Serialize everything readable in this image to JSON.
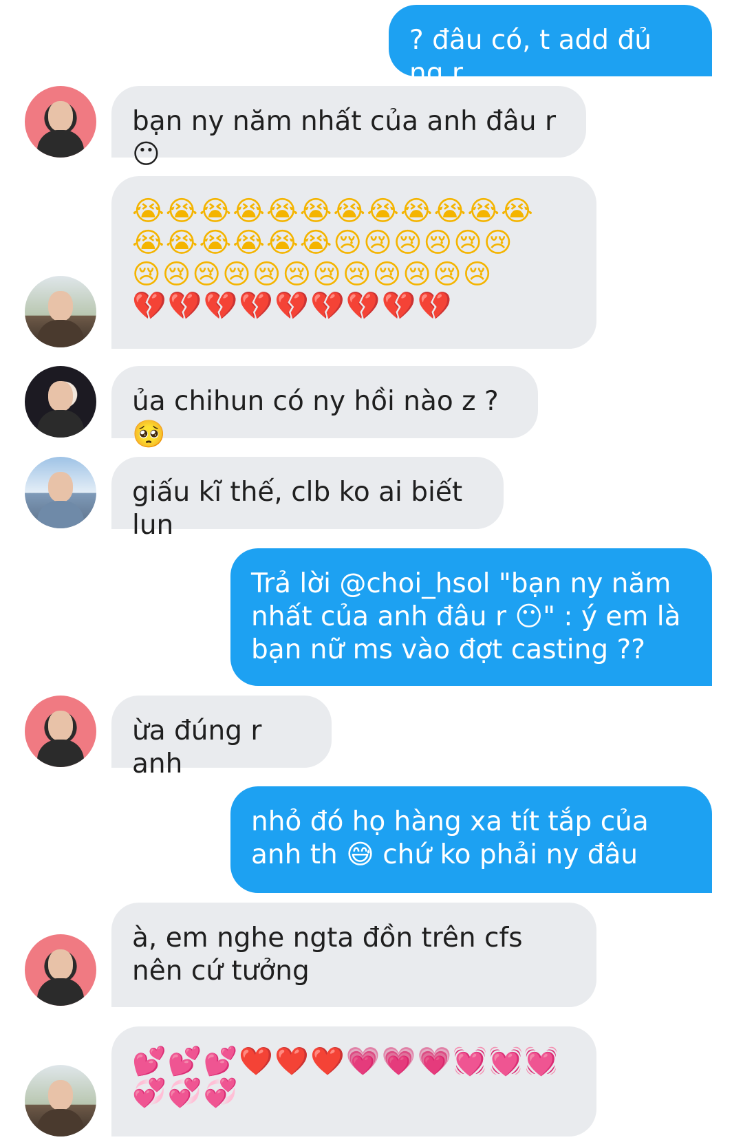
{
  "messages": [
    {
      "side": "out",
      "text": "? đâu có, t add đủ ng r"
    },
    {
      "side": "in",
      "avatar": "avatar-a",
      "text": "bạn ny năm nhất của anh đâu r 😶"
    },
    {
      "side": "in",
      "avatar": "avatar-b",
      "emoji_rows": [
        "😭😭😭😭😭😭😭😭😭😭😭😭",
        "😭😭😭😭😭😭😢😢😢😢😢😢",
        "😢😢😢😢😢😢😢😢😢😢😢😢",
        "💔💔💔💔💔💔💔💔💔"
      ]
    },
    {
      "side": "in",
      "avatar": "avatar-c",
      "text": "ủa chihun có ny hồi nào z ? 🥺"
    },
    {
      "side": "in",
      "avatar": "avatar-d",
      "text": "giấu kĩ thế, clb ko ai biết lun"
    },
    {
      "side": "out",
      "text": "Trả lời @choi_hsol \"bạn ny năm nhất của anh đâu r 😶\" : ý em là bạn nữ ms vào đợt casting ??"
    },
    {
      "side": "in",
      "avatar": "avatar-a",
      "text": "ừa đúng r anh"
    },
    {
      "side": "out",
      "text": "nhỏ đó họ hàng xa tít tắp của anh th 😅 chứ ko phải ny đâu"
    },
    {
      "side": "in",
      "avatar": "avatar-a",
      "text": "à, em nghe ngta đồn trên cfs nên cứ tưởng"
    },
    {
      "side": "in",
      "avatar": "avatar-b",
      "emoji_rows": [
        "💕💕💕❤️❤️❤️💗💗💗💓💓💓",
        "💞💞💞"
      ]
    }
  ],
  "colors": {
    "outgoing_bubble": "#1da1f2",
    "incoming_bubble": "#e9ebee",
    "outgoing_text": "#ffffff",
    "incoming_text": "#1f1f1f"
  }
}
